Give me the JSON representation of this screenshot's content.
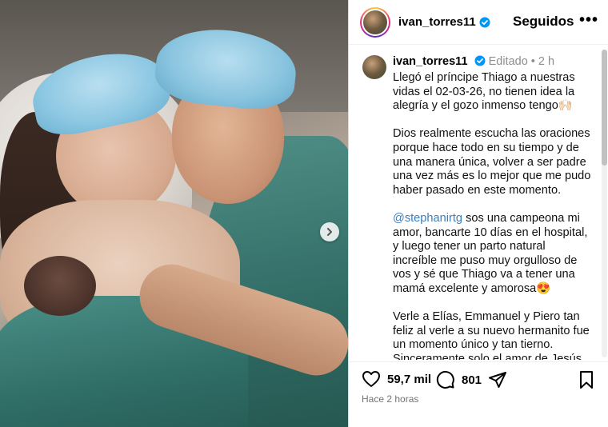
{
  "header": {
    "username": "ivan_torres11",
    "follow_status": "Seguidos",
    "more": "•••"
  },
  "caption": {
    "username": "ivan_torres11",
    "edited": "Editado",
    "separator": "•",
    "time_ago": "2 h",
    "paragraphs": [
      "Llegó el príncipe Thiago a nuestras vidas el 02-03-26, no tienen idea la alegría y el gozo inmenso tengo🙌🏻",
      "Dios realmente escucha las oraciones porque hace todo en su tiempo y de una manera única, volver a ser padre una vez más es lo mejor que me pudo haber pasado en este momento."
    ],
    "mention": "@stephanirtg",
    "mention_paragraph_rest": " sos una campeona mi amor, bancarte 10 días en el hospital, y luego tener un parto natural increíble me puso muy orgulloso de vos y sé que Thiago va a tener una mamá excelente y amorosa😍",
    "last_paragraph": "Verle a Elías, Emmanuel y Piero tan feliz al verle a su nuevo hermanito fue un momento único y tan tierno. Sinceramente solo el amor de Jesús"
  },
  "actions": {
    "likes": "59,7 mil",
    "comments": "801",
    "time": "Hace 2 horas"
  },
  "icons": {
    "verified": "verified-badge-icon",
    "like": "heart-icon",
    "comment": "comment-icon",
    "share": "send-icon",
    "save": "bookmark-icon",
    "next": "chevron-right-icon"
  },
  "colors": {
    "verified": "#0095f6",
    "mention": "#3a7fbf",
    "muted": "#8e8e8e"
  }
}
